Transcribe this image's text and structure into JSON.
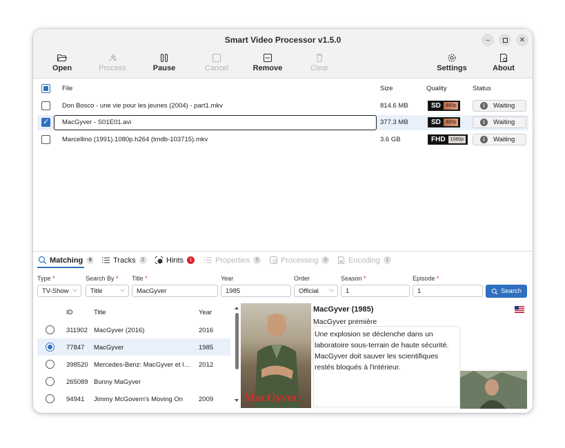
{
  "window": {
    "title": "Smart Video Processor v1.5.0"
  },
  "toolbar": {
    "open": "Open",
    "process": "Process",
    "pause": "Pause",
    "cancel": "Cancel",
    "remove": "Remove",
    "clear": "Clear",
    "settings": "Settings",
    "about": "About"
  },
  "filelist": {
    "headers": {
      "file": "File",
      "size": "Size",
      "quality": "Quality",
      "status": "Status"
    },
    "rows": [
      {
        "name": "Don Bosco - une vie pour les jeunes (2004) - part1.mkv",
        "size": "814.6 MB",
        "quality": "SD",
        "res": "480p",
        "status": "Waiting",
        "checked": false
      },
      {
        "name": "MacGyver - S01E01.avi",
        "size": "377.3 MB",
        "quality": "SD",
        "res": "480p",
        "status": "Waiting",
        "checked": true
      },
      {
        "name": "Marcellino (1991).1080p.h264 (tmdb-103715).mkv",
        "size": "3.6 GB",
        "quality": "FHD",
        "res": "1080p",
        "status": "Waiting",
        "checked": false
      }
    ]
  },
  "tabs": [
    {
      "label": "Matching",
      "count": "8"
    },
    {
      "label": "Tracks",
      "count": "2"
    },
    {
      "label": "Hints",
      "count": "1"
    },
    {
      "label": "Properties",
      "count": "5"
    },
    {
      "label": "Processing",
      "count": "0"
    },
    {
      "label": "Encoding",
      "count": "1"
    }
  ],
  "form": {
    "type_label": "Type",
    "searchby_label": "Search By",
    "title_label": "Title",
    "year_label": "Year",
    "order_label": "Order",
    "season_label": "Season",
    "episode_label": "Episode",
    "req": "*",
    "type_value": "TV-Show",
    "searchby_value": "Title",
    "title_value": "MacGyver",
    "year_value": "1985",
    "order_value": "Official",
    "season_value": "1",
    "episode_value": "1",
    "search_button": "Search"
  },
  "results": {
    "headers": {
      "id": "ID",
      "title": "Title",
      "year": "Year"
    },
    "rows": [
      {
        "id": "311902",
        "title": "MacGyver (2016)",
        "year": "2016"
      },
      {
        "id": "77847",
        "title": "MacGyver",
        "year": "1985"
      },
      {
        "id": "398520",
        "title": "Mercedes-Benz: MacGyver et le ...",
        "year": "2012"
      },
      {
        "id": "265089",
        "title": "Bunny MaGyver",
        "year": ""
      },
      {
        "id": "94941",
        "title": "Jimmy McGovern's Moving On",
        "year": "2009"
      }
    ]
  },
  "poster": {
    "logo": "MacGyver"
  },
  "details": {
    "title": "MacGyver (1985)",
    "episode_title": "MacGyver première",
    "description": "Une explosion se déclenche dans un laboratoire sous-terrain de haute sécurité. MacGyver doit sauver les scientifiques restés bloqués à l'intérieur."
  },
  "colors": {
    "accent": "#2f6fbf",
    "badge_red": "#d8232a"
  }
}
